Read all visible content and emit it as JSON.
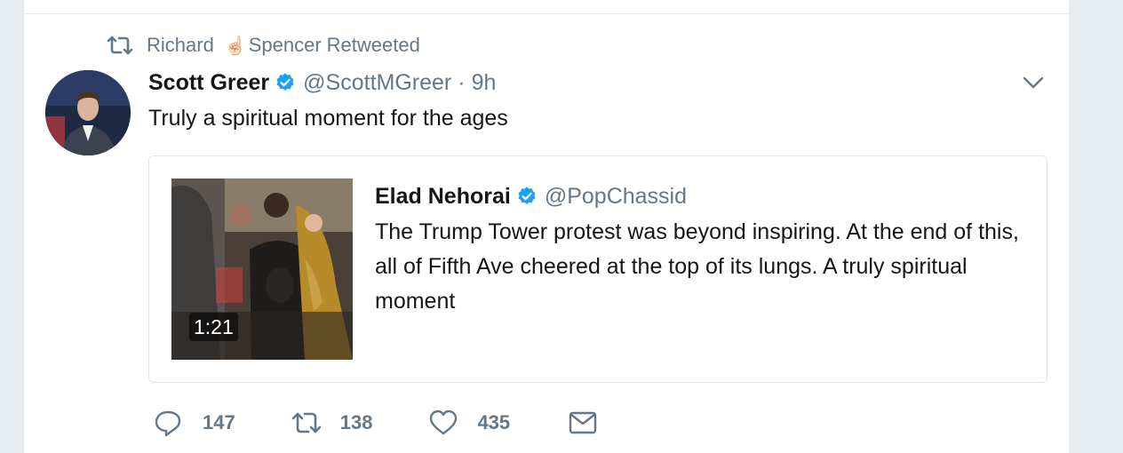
{
  "colors": {
    "background": "#e6ecf0",
    "card": "#ffffff",
    "text": "#14171a",
    "secondary_text": "#657786",
    "verified_blue": "#1da1f2",
    "border": "#e1e8ed"
  },
  "context": {
    "icon": "retweet-icon",
    "name_part1": "Richard",
    "emoji": "☝🏻",
    "name_part2": "Spencer",
    "suffix": "Retweeted"
  },
  "tweet": {
    "name": "Scott Greer",
    "verified_icon": "verified-badge-icon",
    "handle": "@ScottMGreer",
    "separator": "·",
    "time": "9h",
    "text": "Truly a spiritual moment for the ages",
    "menu_icon": "chevron-down-icon"
  },
  "quoted": {
    "name": "Elad Nehorai",
    "handle": "@PopChassid",
    "text": "The Trump Tower protest was beyond inspiring. At the end of this, all of Fifth Ave cheered at the top of its lungs. A truly spiritual moment",
    "video_duration": "1:21"
  },
  "actions": {
    "reply_count": "147",
    "retweet_count": "138",
    "like_count": "435",
    "reply_icon": "reply-icon",
    "retweet_icon": "retweet-icon",
    "like_icon": "heart-icon",
    "dm_icon": "mail-icon"
  }
}
